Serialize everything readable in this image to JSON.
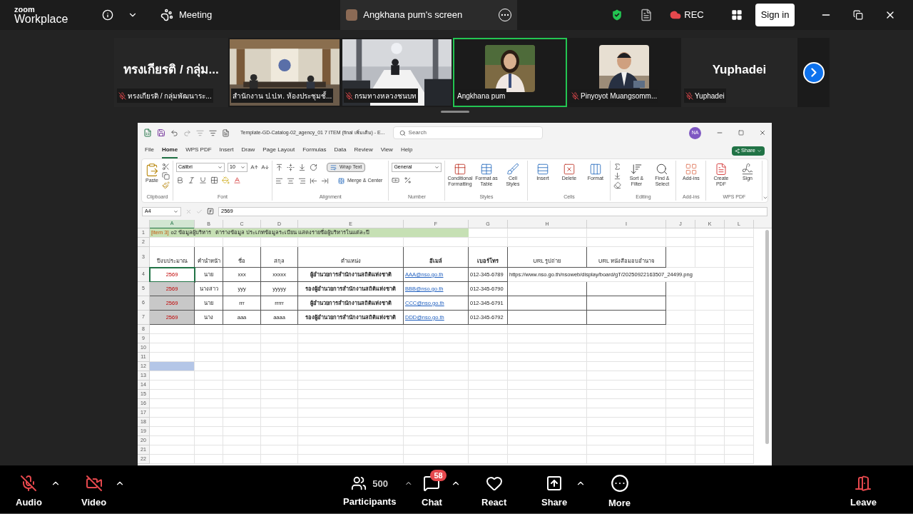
{
  "topbar": {
    "logo_top": "zoom",
    "logo_bottom": "Workplace",
    "meeting": "Meeting",
    "share_tab": "Angkhana pum's screen",
    "rec": "REC",
    "sign_in": "Sign in"
  },
  "gallery": [
    {
      "kind": "name",
      "name": "ทรงเกียรติ / กลุ่ม...",
      "label": "ทรงเกียรติ / กลุ่มพัฒนาระ...",
      "muted": true,
      "speaking": false
    },
    {
      "kind": "video",
      "label": "สำนักงาน ป.ป.ท. ห้องประชุมชั้...",
      "muted": false,
      "speaking": false
    },
    {
      "kind": "video",
      "label": "กรมทางหลวงชนบท",
      "muted": true,
      "speaking": false
    },
    {
      "kind": "avatar",
      "label": "Angkhana pum",
      "muted": false,
      "speaking": true
    },
    {
      "kind": "avatar",
      "label": "Pinyoyot Muangsomm...",
      "muted": true,
      "speaking": false
    },
    {
      "kind": "name",
      "name": "Yuphadei",
      "label": "Yuphadei",
      "muted": true,
      "speaking": false
    }
  ],
  "excel": {
    "title": "Template-GD-Catalog-02_agency_01 7 ITEM (final เพิ่มเติม) - E...",
    "search_placeholder": "Search",
    "avatar": "NA",
    "share": "Share",
    "tabs": [
      {
        "label": "File",
        "selected": false
      },
      {
        "label": "Home",
        "selected": true
      },
      {
        "label": "WPS PDF",
        "selected": false
      },
      {
        "label": "Insert",
        "selected": false
      },
      {
        "label": "Draw",
        "selected": false
      },
      {
        "label": "Page Layout",
        "selected": false
      },
      {
        "label": "Formulas",
        "selected": false
      },
      {
        "label": "Data",
        "selected": false
      },
      {
        "label": "Review",
        "selected": false
      },
      {
        "label": "View",
        "selected": false
      },
      {
        "label": "Help",
        "selected": false
      }
    ],
    "ribbon": [
      {
        "kind": "clipboard",
        "label": "Clipboard",
        "buttons": [
          "Paste"
        ]
      },
      {
        "kind": "font",
        "label": "Font",
        "font": "Calibri",
        "size": "10"
      },
      {
        "kind": "alignment",
        "label": "Alignment",
        "buttons": [
          "Wrap Text",
          "Merge & Center"
        ]
      },
      {
        "kind": "number",
        "label": "Number",
        "format": "General"
      },
      {
        "kind": "buttons",
        "label": "Styles",
        "buttons": [
          "Conditional Formatting",
          "Format as Table",
          "Cell Styles"
        ]
      },
      {
        "kind": "buttons",
        "label": "Cells",
        "buttons": [
          "Insert",
          "Delete",
          "Format"
        ]
      },
      {
        "kind": "editing",
        "label": "Editing",
        "buttons": [
          "Sort & Filter",
          "Find & Select"
        ]
      },
      {
        "kind": "buttons",
        "label": "Add-ins",
        "buttons": [
          "Add-ins"
        ]
      },
      {
        "kind": "buttons",
        "label": "WPS PDF",
        "buttons": [
          "Create PDF",
          "Sign"
        ]
      }
    ],
    "name_box": "A4",
    "formula": "2569",
    "columns": [
      {
        "label": "A",
        "selected": true
      },
      {
        "label": "B",
        "selected": false
      },
      {
        "label": "C",
        "selected": false
      },
      {
        "label": "D",
        "selected": false
      },
      {
        "label": "E",
        "selected": false
      },
      {
        "label": "F",
        "selected": false
      },
      {
        "label": "G",
        "selected": false
      },
      {
        "label": "H",
        "selected": false
      },
      {
        "label": "I",
        "selected": false
      },
      {
        "label": "J",
        "selected": false
      },
      {
        "label": "K",
        "selected": false
      },
      {
        "label": "L",
        "selected": false
      }
    ],
    "rows": [
      {
        "number": "1",
        "kind": "title",
        "tag": "[item 3]",
        "text": "o2 ข้อมูลผู้บริหาร   ตารางข้อมูล ประเภทข้อมูลระเบียน แสดงรายชื่อผู้บริหารในแต่ละปี"
      },
      {
        "number": "2",
        "kind": "empty",
        "highlighted": false
      },
      {
        "number": "3",
        "kind": "header",
        "cells": [
          "ปีงบประมาณ",
          "คำนำหน้า",
          "ชื่อ",
          "สกุล",
          "ตำแหน่ง",
          "อีเมล์",
          "เบอร์โทร",
          "URL รูปถ่าย",
          "URL หนังสือมอบอำนาจ"
        ]
      },
      {
        "number": "4",
        "kind": "data",
        "active": true,
        "selected": false,
        "cells": [
          "2569",
          "นาย",
          "xxx",
          "xxxxx",
          "ผู้อำนวยการสำนักงานสถิติแห่งชาติ",
          "AAA@nso.go.th",
          "012-345-6789",
          "https://www.nso.go.th/nsoweb/display/board/gT/20250922163507_24499.png"
        ]
      },
      {
        "number": "5",
        "kind": "data",
        "active": false,
        "selected": true,
        "cells": [
          "2569",
          "นางสาว",
          "yyy",
          "yyyyy",
          "รองผู้อำนวยการสำนักงานสถิติแห่งชาติ",
          "BBB@nso.go.th",
          "012-345-6790"
        ]
      },
      {
        "number": "6",
        "kind": "data",
        "active": false,
        "selected": true,
        "cells": [
          "2569",
          "นาย",
          "rrr",
          "rrrrr",
          "ผู้อำนวยการสำนักงานสถิติแห่งชาติ",
          "CCC@nso.go.th",
          "012-345-6791"
        ]
      },
      {
        "number": "7",
        "kind": "data",
        "active": false,
        "selected": true,
        "cells": [
          "2569",
          "นาง",
          "aaa",
          "aaaa",
          "รองผู้อำนวยการสำนักงานสถิติแห่งชาติ",
          "DDD@nso.go.th",
          "012-345-6792"
        ]
      },
      {
        "number": "8",
        "kind": "empty",
        "highlighted": false
      },
      {
        "number": "9",
        "kind": "empty",
        "highlighted": false
      },
      {
        "number": "10",
        "kind": "empty",
        "highlighted": false
      },
      {
        "number": "11",
        "kind": "empty",
        "highlighted": false
      },
      {
        "number": "12",
        "kind": "empty",
        "highlighted": true
      },
      {
        "number": "13",
        "kind": "empty",
        "highlighted": false
      },
      {
        "number": "14",
        "kind": "empty",
        "highlighted": false
      },
      {
        "number": "15",
        "kind": "empty",
        "highlighted": false
      },
      {
        "number": "16",
        "kind": "empty",
        "highlighted": false
      },
      {
        "number": "17",
        "kind": "empty",
        "highlighted": false
      },
      {
        "number": "18",
        "kind": "empty",
        "highlighted": false
      },
      {
        "number": "19",
        "kind": "empty",
        "highlighted": false
      },
      {
        "number": "20",
        "kind": "empty",
        "highlighted": false
      },
      {
        "number": "21",
        "kind": "empty",
        "highlighted": false
      },
      {
        "number": "22",
        "kind": "empty",
        "highlighted": false
      }
    ]
  },
  "toolbar": [
    {
      "kind": "audio",
      "label": "Audio",
      "muted": true
    },
    {
      "kind": "video",
      "label": "Video",
      "muted": true
    },
    {
      "kind": "participants",
      "label": "Participants",
      "count": "500"
    },
    {
      "kind": "chat",
      "label": "Chat",
      "badge": "58"
    },
    {
      "kind": "react",
      "label": "React"
    },
    {
      "kind": "share",
      "label": "Share"
    },
    {
      "kind": "more",
      "label": "More"
    },
    {
      "kind": "leave",
      "label": "Leave"
    }
  ]
}
